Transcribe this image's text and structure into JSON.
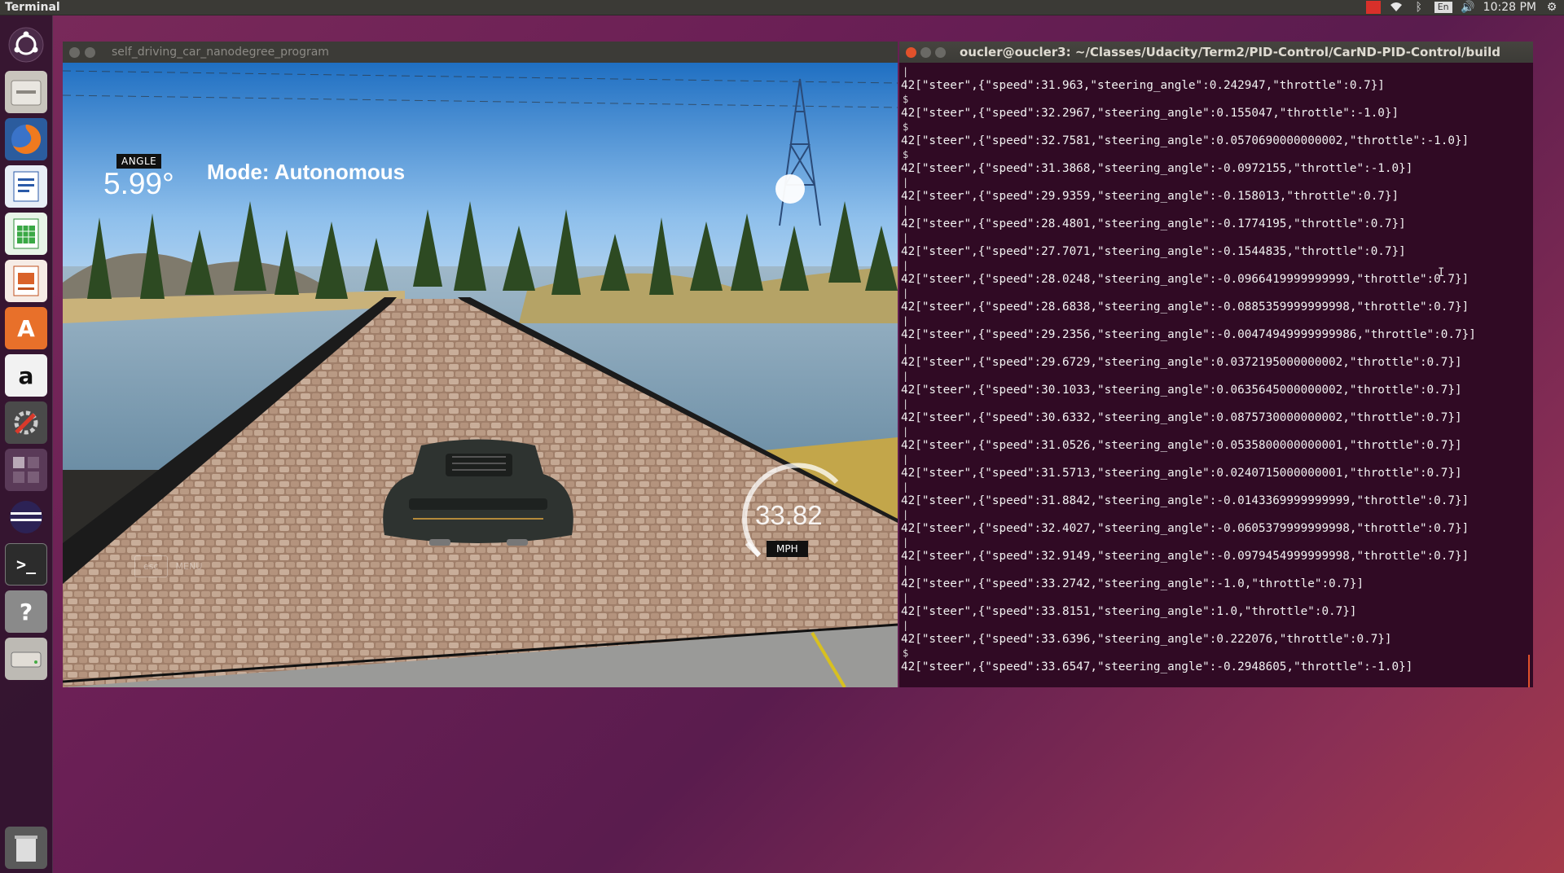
{
  "top_panel": {
    "app_name": "Terminal",
    "clock": "10:28 PM",
    "keyboard_layout": "En"
  },
  "launcher": {
    "items": [
      {
        "name": "ubuntu-dash-icon"
      },
      {
        "name": "files-icon"
      },
      {
        "name": "firefox-icon"
      },
      {
        "name": "writer-icon"
      },
      {
        "name": "calc-icon"
      },
      {
        "name": "impress-icon"
      },
      {
        "name": "software-center-icon"
      },
      {
        "name": "amazon-icon"
      },
      {
        "name": "system-settings-icon"
      },
      {
        "name": "workspace-switcher-icon"
      },
      {
        "name": "eclipse-icon"
      },
      {
        "name": "terminal-icon"
      },
      {
        "name": "help-icon"
      },
      {
        "name": "drive-icon"
      },
      {
        "name": "trash-icon"
      }
    ]
  },
  "simulator": {
    "title": "self_driving_car_nanodegree_program",
    "angle_label": "ANGLE",
    "angle_value": "5.99°",
    "mode": "Mode: Autonomous",
    "speed": "33.82",
    "speed_unit": "MPH",
    "esc_label": "esc",
    "menu_label": "MENU"
  },
  "terminal": {
    "title": "oucler@oucler3: ~/Classes/Udacity/Term2/PID-Control/CarND-PID-Control/build",
    "lines": [
      {
        "pre": "|",
        "msg": "42[\"steer\",{\"speed\":31.963,\"steering_angle\":0.242947,\"throttle\":0.7}]"
      },
      {
        "pre": "$",
        "msg": "42[\"steer\",{\"speed\":32.2967,\"steering_angle\":0.155047,\"throttle\":-1.0}]"
      },
      {
        "pre": "$",
        "msg": "42[\"steer\",{\"speed\":32.7581,\"steering_angle\":0.0570690000000002,\"throttle\":-1.0}]"
      },
      {
        "pre": "$",
        "msg": "42[\"steer\",{\"speed\":31.3868,\"steering_angle\":-0.0972155,\"throttle\":-1.0}]"
      },
      {
        "pre": "|",
        "msg": "42[\"steer\",{\"speed\":29.9359,\"steering_angle\":-0.158013,\"throttle\":0.7}]"
      },
      {
        "pre": "|",
        "msg": "42[\"steer\",{\"speed\":28.4801,\"steering_angle\":-0.1774195,\"throttle\":0.7}]"
      },
      {
        "pre": "|",
        "msg": "42[\"steer\",{\"speed\":27.7071,\"steering_angle\":-0.1544835,\"throttle\":0.7}]"
      },
      {
        "pre": "|",
        "msg": "42[\"steer\",{\"speed\":28.0248,\"steering_angle\":-0.0966419999999999,\"throttle\":0.7}]"
      },
      {
        "pre": "|",
        "msg": "42[\"steer\",{\"speed\":28.6838,\"steering_angle\":-0.0885359999999998,\"throttle\":0.7}]"
      },
      {
        "pre": "|",
        "msg": "42[\"steer\",{\"speed\":29.2356,\"steering_angle\":-0.00474949999999986,\"throttle\":0.7}]"
      },
      {
        "pre": "|",
        "msg": "42[\"steer\",{\"speed\":29.6729,\"steering_angle\":0.0372195000000002,\"throttle\":0.7}]"
      },
      {
        "pre": "|",
        "msg": "42[\"steer\",{\"speed\":30.1033,\"steering_angle\":0.0635645000000002,\"throttle\":0.7}]"
      },
      {
        "pre": "|",
        "msg": "42[\"steer\",{\"speed\":30.6332,\"steering_angle\":0.0875730000000002,\"throttle\":0.7}]"
      },
      {
        "pre": "|",
        "msg": "42[\"steer\",{\"speed\":31.0526,\"steering_angle\":0.0535800000000001,\"throttle\":0.7}]"
      },
      {
        "pre": "|",
        "msg": "42[\"steer\",{\"speed\":31.5713,\"steering_angle\":0.0240715000000001,\"throttle\":0.7}]"
      },
      {
        "pre": "|",
        "msg": "42[\"steer\",{\"speed\":31.8842,\"steering_angle\":-0.0143369999999999,\"throttle\":0.7}]"
      },
      {
        "pre": "|",
        "msg": "42[\"steer\",{\"speed\":32.4027,\"steering_angle\":-0.0605379999999998,\"throttle\":0.7}]"
      },
      {
        "pre": "|",
        "msg": "42[\"steer\",{\"speed\":32.9149,\"steering_angle\":-0.0979454999999998,\"throttle\":0.7}]"
      },
      {
        "pre": "|",
        "msg": "42[\"steer\",{\"speed\":33.2742,\"steering_angle\":-1.0,\"throttle\":0.7}]"
      },
      {
        "pre": "|",
        "msg": "42[\"steer\",{\"speed\":33.8151,\"steering_angle\":1.0,\"throttle\":0.7}]"
      },
      {
        "pre": "|",
        "msg": "42[\"steer\",{\"speed\":33.6396,\"steering_angle\":0.222076,\"throttle\":0.7}]"
      },
      {
        "pre": "$",
        "msg": "42[\"steer\",{\"speed\":33.6547,\"steering_angle\":-0.2948605,\"throttle\":-1.0}]"
      }
    ]
  }
}
